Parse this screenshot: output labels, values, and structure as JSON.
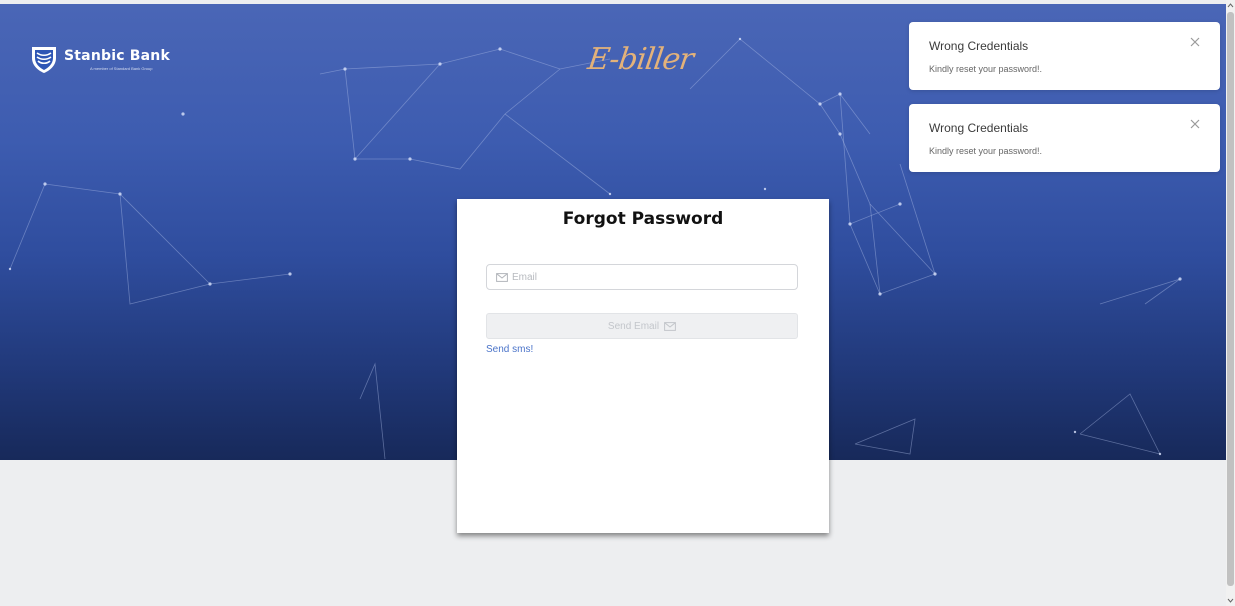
{
  "brand": {
    "name": "Stanbic Bank",
    "tagline": "A member of Standard Bank Group",
    "logo_icon": "stanbic-shield-icon",
    "app_name": "E-biller"
  },
  "forgot_password": {
    "title": "Forgot Password",
    "email_placeholder": "Email",
    "email_icon": "envelope-icon",
    "send_email_label": "Send Email",
    "send_sms_link": "Send sms!"
  },
  "toasts": [
    {
      "title": "Wrong Credentials",
      "message": "Kindly reset your password!.",
      "close_icon": "close-icon"
    },
    {
      "title": "Wrong Credentials",
      "message": "Kindly reset your password!.",
      "close_icon": "close-icon"
    }
  ],
  "colors": {
    "hero_top": "#4a66b6",
    "hero_bottom": "#17295a",
    "page_background": "#edeef0",
    "app_name_accent": "#e3b27a",
    "link": "#4b74c9"
  }
}
